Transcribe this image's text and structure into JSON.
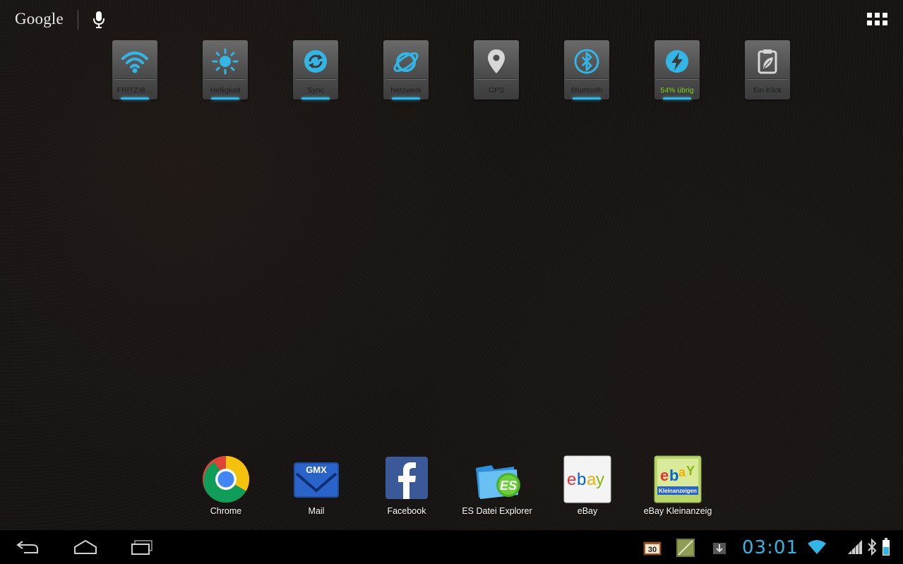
{
  "search": {
    "brand": "Google",
    "mic_icon": "microphone-icon"
  },
  "apps_button_icon": "all-apps-grid-icon",
  "power_widget": {
    "accent": "#33b5e5",
    "tiles": [
      {
        "label": "FRITZ!B…",
        "icon": "wifi-icon",
        "active": true
      },
      {
        "label": "Helligkeit",
        "icon": "brightness-icon",
        "active": true
      },
      {
        "label": "Sync",
        "icon": "sync-icon",
        "active": true
      },
      {
        "label": "Netzwerk",
        "icon": "network-globe-icon",
        "active": true
      },
      {
        "label": "GPS",
        "icon": "location-pin-icon",
        "active": false
      },
      {
        "label": "Bluetooth",
        "icon": "bluetooth-icon",
        "active": true
      },
      {
        "label": "54% übrig",
        "icon": "battery-bolt-icon",
        "active": true
      },
      {
        "label": "Ein Klick",
        "icon": "clipboard-leaf-icon",
        "active": false
      }
    ]
  },
  "dock": [
    {
      "label": "Chrome",
      "icon": "chrome-icon"
    },
    {
      "label": "Mail",
      "icon": "gmx-mail-icon",
      "badge": "GMX"
    },
    {
      "label": "Facebook",
      "icon": "facebook-icon"
    },
    {
      "label": "ES Datei Explorer",
      "icon": "es-file-explorer-icon"
    },
    {
      "label": "eBay",
      "icon": "ebay-icon"
    },
    {
      "label": "eBay Kleinanzeig",
      "icon": "ebay-kleinanzeigen-icon",
      "sub": "Kleinanzeigen"
    }
  ],
  "navbar": {
    "back_icon": "back-icon",
    "home_icon": "home-icon",
    "recents_icon": "recent-apps-icon",
    "notification_calendar": "30",
    "clock": "03:01"
  }
}
